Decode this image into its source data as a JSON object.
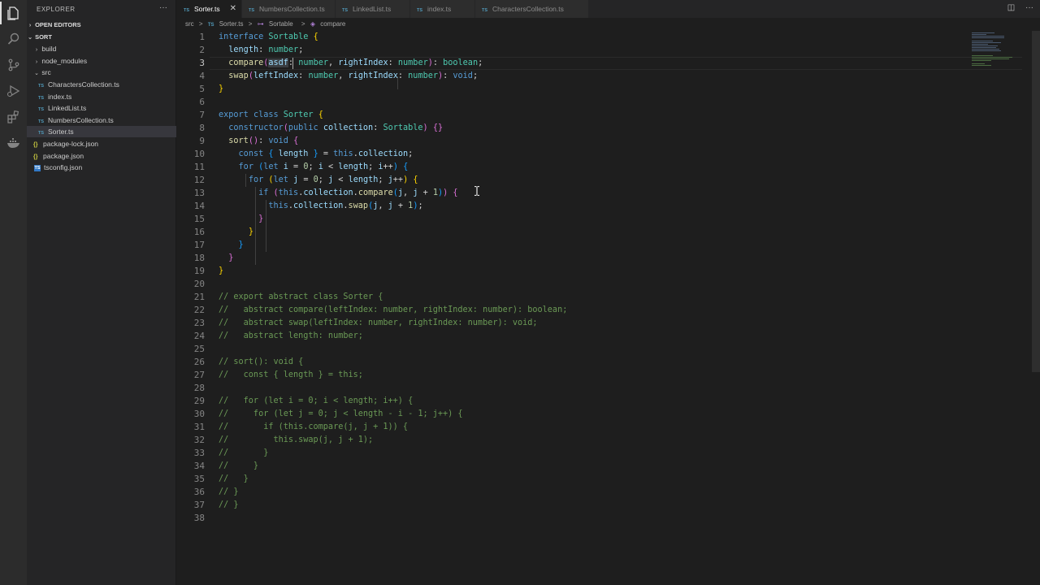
{
  "sidebar": {
    "header": "EXPLORER",
    "open_editors": "OPEN EDITORS",
    "project": "SORT",
    "items": [
      {
        "label": "build",
        "type": "folder"
      },
      {
        "label": "node_modules",
        "type": "folder"
      },
      {
        "label": "src",
        "type": "folder-open"
      },
      {
        "label": "CharactersCollection.ts",
        "type": "ts"
      },
      {
        "label": "index.ts",
        "type": "ts"
      },
      {
        "label": "LinkedList.ts",
        "type": "ts"
      },
      {
        "label": "NumbersCollection.ts",
        "type": "ts"
      },
      {
        "label": "Sorter.ts",
        "type": "ts",
        "selected": true
      },
      {
        "label": "package-lock.json",
        "type": "json"
      },
      {
        "label": "package.json",
        "type": "json"
      },
      {
        "label": "tsconfig.json",
        "type": "tsconfig"
      }
    ]
  },
  "tabs": [
    {
      "label": "Sorter.ts",
      "active": true
    },
    {
      "label": "NumbersCollection.ts"
    },
    {
      "label": "LinkedList.ts"
    },
    {
      "label": "index.ts"
    },
    {
      "label": "CharactersCollection.ts"
    }
  ],
  "tab_badge": "TS",
  "breadcrumb": {
    "parts": [
      "src",
      ">",
      "TS",
      "Sorter.ts",
      ">",
      "Sortable",
      ">",
      "compare"
    ]
  },
  "editor": {
    "current_line": 3,
    "line_numbers": [
      "1",
      "2",
      "3",
      "4",
      "5",
      "6",
      "7",
      "8",
      "9",
      "10",
      "11",
      "12",
      "13",
      "14",
      "15",
      "16",
      "17",
      "18",
      "19",
      "20",
      "21",
      "22",
      "23",
      "24",
      "25",
      "26",
      "27",
      "28",
      "29",
      "30",
      "31",
      "32",
      "33",
      "34",
      "35",
      "36",
      "37",
      "38"
    ],
    "comment_lines": {
      "21": "// export abstract class Sorter {",
      "22": "//   abstract compare(leftIndex: number, rightIndex: number): boolean;",
      "23": "//   abstract swap(leftIndex: number, rightIndex: number): void;",
      "24": "//   abstract length: number;",
      "26": "// sort(): void {",
      "27": "//   const { length } = this;",
      "29": "//   for (let i = 0; i < length; i++) {",
      "30": "//     for (let j = 0; j < length - i - 1; j++) {",
      "31": "//       if (this.compare(j, j + 1)) {",
      "32": "//         this.swap(j, j + 1);",
      "33": "//       }",
      "34": "//     }",
      "35": "//   }",
      "36": "// }",
      "37": "// }"
    }
  },
  "colors": {
    "keyword": "#569cd6",
    "type": "#4ec9b0",
    "function": "#dcdcaa",
    "property": "#9cdcfe",
    "number": "#b5cea8",
    "comment": "#6a9955",
    "bracket_gold": "#ffd700",
    "bracket_orchid": "#da70d6",
    "bracket_blue": "#179fff"
  }
}
